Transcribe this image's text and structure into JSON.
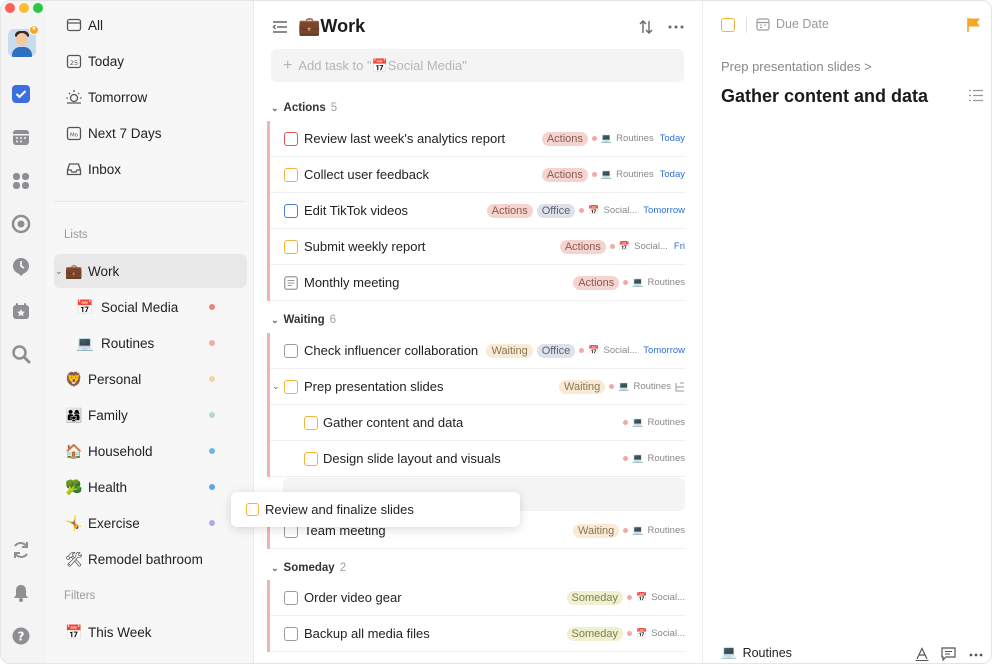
{
  "sidebar": {
    "smart": [
      {
        "label": "All",
        "icon": "all-icon"
      },
      {
        "label": "Today",
        "icon": "today-icon"
      },
      {
        "label": "Tomorrow",
        "icon": "tomorrow-icon"
      },
      {
        "label": "Next 7 Days",
        "icon": "next7-icon"
      },
      {
        "label": "Inbox",
        "icon": "inbox-icon"
      }
    ],
    "lists_label": "Lists",
    "lists": [
      {
        "label": "Work",
        "emoji": "💼",
        "color": ""
      },
      {
        "label": "Social Media",
        "emoji": "📅",
        "color": "#e8857a"
      },
      {
        "label": "Routines",
        "emoji": "💻",
        "color": "#f2aaa4"
      },
      {
        "label": "Personal",
        "emoji": "🦁",
        "color": "#f6d59b"
      },
      {
        "label": "Family",
        "emoji": "👨‍👩‍👧",
        "color": "#b9d8c8"
      },
      {
        "label": "Household",
        "emoji": "🏠",
        "color": "#6eb7e3"
      },
      {
        "label": "Health",
        "emoji": "🥦",
        "color": "#5ea5e8"
      },
      {
        "label": "Exercise",
        "emoji": "🤸",
        "color": "#b8a5e8"
      },
      {
        "label": "Remodel bathroom",
        "emoji": "🛠",
        "color": ""
      }
    ],
    "filters_label": "Filters",
    "filters": [
      {
        "label": "This Week",
        "emoji": "📅"
      }
    ]
  },
  "main": {
    "title": "Work",
    "title_emoji": "💼",
    "add_placeholder": "Add task to \"📅Social Media\"",
    "groups": [
      {
        "name": "Actions",
        "count": "5"
      },
      {
        "name": "Waiting",
        "count": "6"
      },
      {
        "name": "Someday",
        "count": "2"
      }
    ],
    "tasks": [
      {
        "title": "Review last week's analytics report",
        "tags": [
          "Actions"
        ],
        "list": "Routines",
        "date": "Today",
        "checkbox_color": "#e05555"
      },
      {
        "title": "Collect user feedback",
        "tags": [
          "Actions"
        ],
        "list": "Routines",
        "date": "Today",
        "checkbox_color": "#f3b33d"
      },
      {
        "title": "Edit TikTok videos",
        "tags": [
          "Actions",
          "Office"
        ],
        "list": "Social...",
        "date": "Tomorrow",
        "checkbox_color": "#4a7fd6"
      },
      {
        "title": "Submit weekly report",
        "tags": [
          "Actions"
        ],
        "list": "Social...",
        "date": "Fri",
        "checkbox_color": "#f3b33d"
      },
      {
        "title": "Monthly meeting",
        "tags": [
          "Actions"
        ],
        "list": "Routines",
        "date": "",
        "checkbox_color": "#9a9a9a"
      },
      {
        "title": "Check influencer collaboration",
        "tags": [
          "Waiting",
          "Office"
        ],
        "list": "Social...",
        "date": "Tomorrow",
        "checkbox_color": "#9a9a9a"
      },
      {
        "title": "Prep presentation slides",
        "tags": [
          "Waiting"
        ],
        "list": "Routines",
        "date": "",
        "checkbox_color": "#f3b33d"
      },
      {
        "title": "Gather content and data",
        "tags": [],
        "list": "Routines",
        "date": "",
        "checkbox_color": "#f3b33d"
      },
      {
        "title": "Design slide layout and visuals",
        "tags": [],
        "list": "Routines",
        "date": "",
        "checkbox_color": "#f3b33d"
      },
      {
        "title": "Team meeting",
        "tags": [
          "Waiting"
        ],
        "list": "Routines",
        "date": "",
        "checkbox_color": "#9a9a9a"
      },
      {
        "title": "Order video gear",
        "tags": [
          "Someday"
        ],
        "list": "Social...",
        "date": "",
        "checkbox_color": "#9a9a9a"
      },
      {
        "title": "Backup all media files",
        "tags": [
          "Someday"
        ],
        "list": "Social...",
        "date": "",
        "checkbox_color": "#9a9a9a"
      }
    ],
    "drag_popup": "Review and finalize slides"
  },
  "detail": {
    "due_date_label": "Due Date",
    "breadcrumb": "Prep presentation slides >",
    "title": "Gather content and data",
    "list_name": "Routines"
  },
  "colors": {
    "accent": "#3b6fe0",
    "flag": "#f5a623"
  }
}
